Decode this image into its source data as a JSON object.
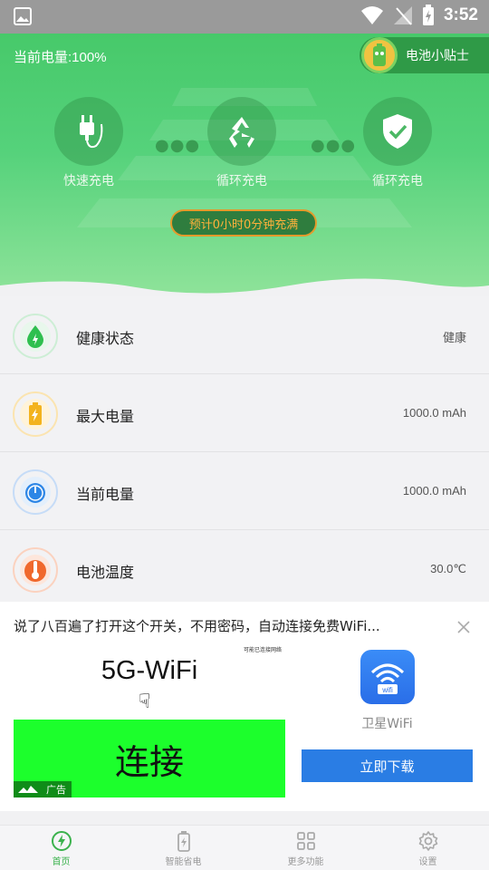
{
  "status_bar": {
    "time": "3:52"
  },
  "header": {
    "battery_level": "当前电量:100%",
    "tips_label": "电池小贴士"
  },
  "modes": [
    {
      "label": "快速充电",
      "icon": "plug-icon"
    },
    {
      "label": "循环充电",
      "icon": "recycle-icon"
    },
    {
      "label": "循环充电",
      "icon": "shield-check-icon"
    }
  ],
  "estimate": "预计0小时0分钟充满",
  "stats": [
    {
      "label": "健康状态",
      "value": "健康",
      "icon": "drop-icon",
      "color": "#2fbf4f"
    },
    {
      "label": "最大电量",
      "value": "1000.0 mAh",
      "icon": "battery-icon",
      "color": "#f3b31e"
    },
    {
      "label": "当前电量",
      "value": "1000.0 mAh",
      "icon": "gauge-icon",
      "color": "#2d86e6"
    },
    {
      "label": "电池温度",
      "value": "30.0℃",
      "icon": "thermometer-icon",
      "color": "#f0682c"
    }
  ],
  "ad": {
    "title": "说了八百遍了打开这个开关，不用密码，自动连接免费WiFi...",
    "image_headline": "5G-WiFi",
    "image_small_text": "可能已连接网络",
    "image_button_text": "连接",
    "ad_mark": "广告",
    "app_name": "卫星WiFi",
    "app_icon_text": "wifi",
    "download_label": "立即下载"
  },
  "nav": [
    {
      "label": "首页",
      "icon": "lightning-circle-icon",
      "active": true
    },
    {
      "label": "智能省电",
      "icon": "battery-charge-icon",
      "active": false
    },
    {
      "label": "更多功能",
      "icon": "grid-icon",
      "active": false
    },
    {
      "label": "设置",
      "icon": "settings-icon",
      "active": false
    }
  ],
  "colors": {
    "primary_green": "#47c96a",
    "accent_orange": "#e49a2b",
    "download_blue": "#2a7de4"
  }
}
